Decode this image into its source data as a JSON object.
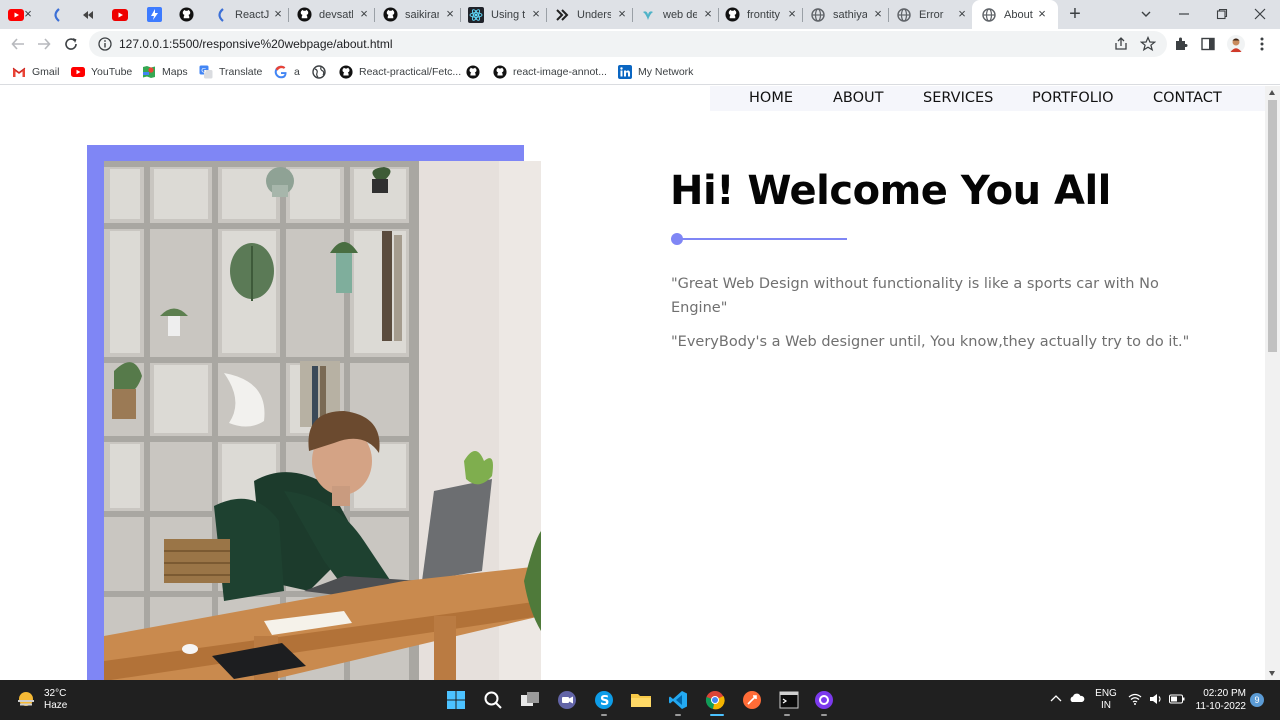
{
  "browser": {
    "tabs": [
      {
        "title": "",
        "icon": "youtube-icon",
        "active": false
      },
      {
        "title": "",
        "icon": "kodekloud-icon",
        "active": false
      },
      {
        "title": "",
        "icon": "back-arrows-icon",
        "active": false
      },
      {
        "title": "",
        "icon": "youtube-icon",
        "active": false
      },
      {
        "title": "",
        "icon": "lightning-icon",
        "active": false
      },
      {
        "title": "",
        "icon": "github-icon",
        "active": false
      },
      {
        "title": "ReactJS",
        "icon": "kodekloud-icon",
        "active": false
      },
      {
        "title": "devsath",
        "icon": "github-icon",
        "active": false
      },
      {
        "title": "saikiran",
        "icon": "github-icon",
        "active": false
      },
      {
        "title": "Using th",
        "icon": "react-icon",
        "active": false
      },
      {
        "title": "Unders",
        "icon": "double-chevron-icon",
        "active": false
      },
      {
        "title": "web de",
        "icon": "bird-icon",
        "active": false
      },
      {
        "title": "frontity",
        "icon": "github-icon",
        "active": false
      },
      {
        "title": "sathiya",
        "icon": "globe-icon",
        "active": false
      },
      {
        "title": "Error",
        "icon": "globe-icon",
        "active": false
      },
      {
        "title": "About",
        "icon": "globe-icon",
        "active": true
      }
    ],
    "url": "127.0.0.1:5500/responsive%20webpage/about.html",
    "bookmarks": [
      {
        "label": "Gmail",
        "icon": "gmail-icon"
      },
      {
        "label": "YouTube",
        "icon": "youtube-icon"
      },
      {
        "label": "Maps",
        "icon": "maps-icon"
      },
      {
        "label": "Translate",
        "icon": "translate-icon"
      },
      {
        "label": "a",
        "icon": "google-icon"
      },
      {
        "label": "",
        "icon": "globe-icon"
      },
      {
        "label": "React-practical/Fetc...",
        "icon": "github-icon"
      },
      {
        "label": "",
        "icon": "github-icon"
      },
      {
        "label": "react-image-annot...",
        "icon": "github-icon"
      },
      {
        "label": "My Network",
        "icon": "linkedin-icon"
      }
    ]
  },
  "site": {
    "nav": [
      "HOME",
      "ABOUT",
      "SERVICES",
      "PORTFOLIO",
      "CONTACT"
    ],
    "title": "Hi! Welcome You All",
    "quote1": "\"Great Web Design without functionality is like a sports car with No Engine\"",
    "quote2": "\"EveryBody's a Web designer until, You know,they actually try to do it.\"",
    "accent_color": "#7f86f5"
  },
  "taskbar": {
    "temperature": "32°C",
    "weather": "Haze",
    "language": "ENG",
    "region": "IN",
    "time": "02:20 PM",
    "date": "11-10-2022",
    "notifications": "9"
  }
}
